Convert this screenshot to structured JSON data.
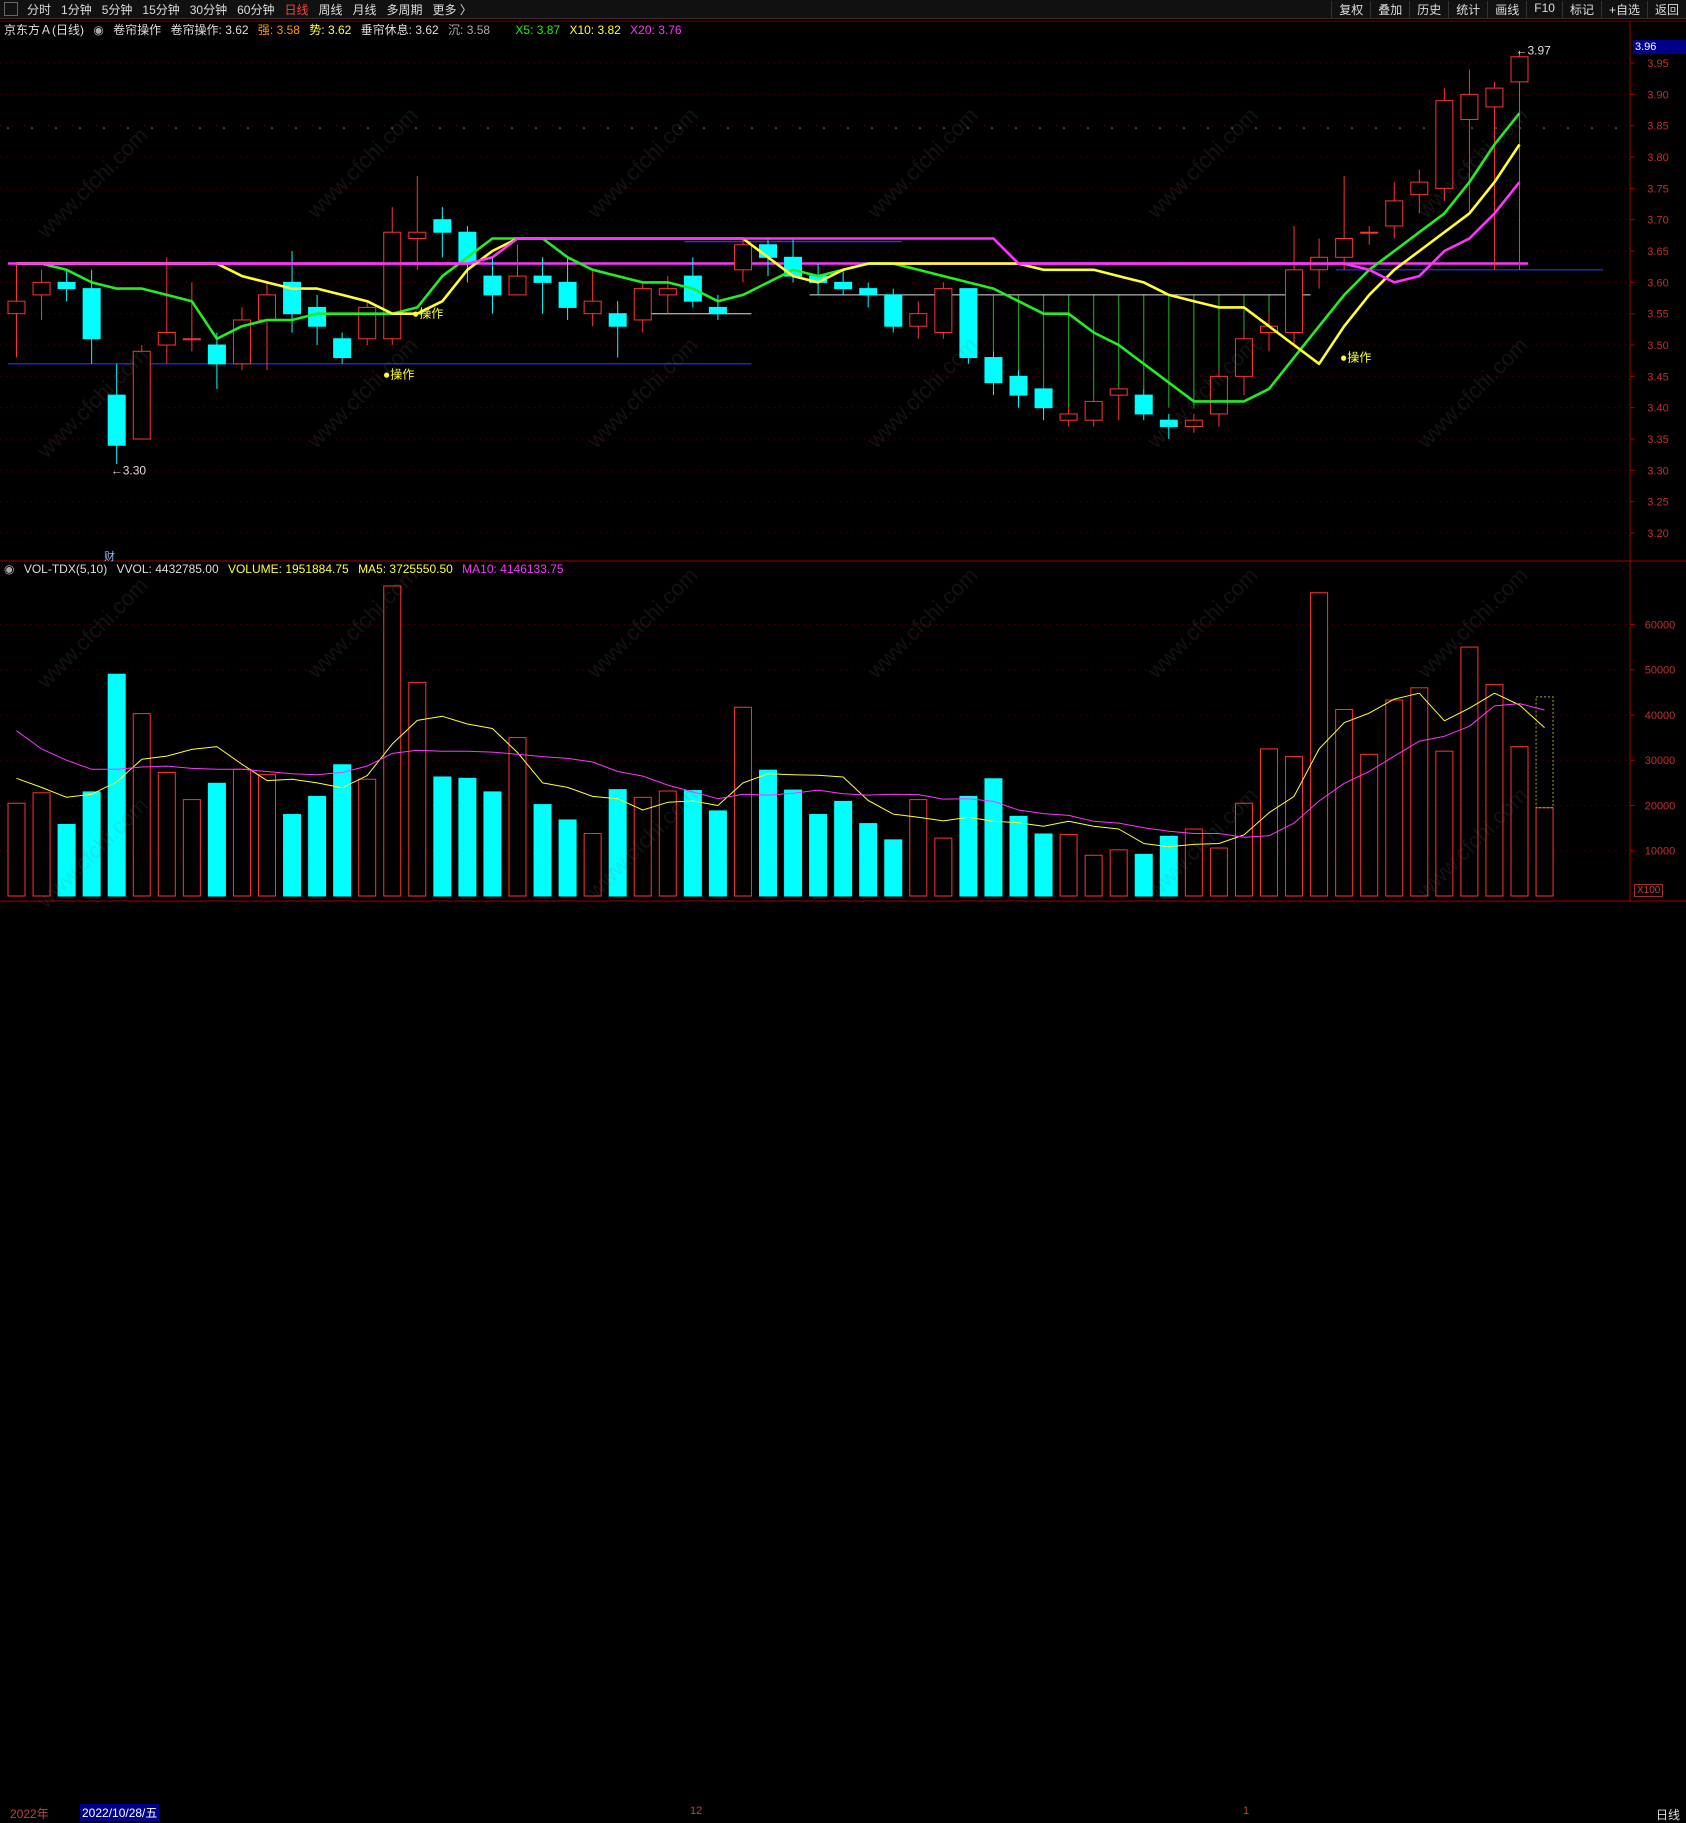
{
  "toolbar": {
    "left_items": [
      "分时",
      "1分钟",
      "5分钟",
      "15分钟",
      "30分钟",
      "60分钟",
      "日线",
      "周线",
      "月线",
      "多周期",
      "更多 〉"
    ],
    "active": "日线",
    "right_items": [
      "复权",
      "叠加",
      "历史",
      "统计",
      "画线",
      "F10",
      "标记",
      "+自选",
      "返回"
    ]
  },
  "legend": {
    "title": "京东方Ａ(日线)",
    "indicator": "卷帘操作",
    "op": "卷帘操作: 3.62",
    "qiang": "强: 3.58",
    "shi": "势: 3.62",
    "rest": "垂帘休息: 3.62",
    "chen": "沉: 3.58",
    "x5": "X5: 3.87",
    "x10": "X10: 3.82",
    "x20": "X20: 3.76"
  },
  "vol_legend": {
    "name": "VOL-TDX(5,10)",
    "vvol": "VVOL: 4432785.00",
    "volume": "VOLUME: 1951884.75",
    "ma5": "MA5: 3725550.50",
    "ma10": "MA10: 4146133.75"
  },
  "annotations": {
    "low": "←3.30",
    "high": "←3.97",
    "cur_price": "3.96",
    "op1": "●操作",
    "op2": "●操作",
    "op3": "●操作",
    "cai": "财",
    "x100": "X100"
  },
  "bottom": {
    "year": "2022年",
    "date": "2022/10/28/五",
    "tick12": "12",
    "tick1": "1",
    "view": "日线"
  },
  "watermark": "www.cfchi.com",
  "colors": {
    "up": "#ff3232",
    "down": "#00ffff",
    "x5": "#22ee22",
    "x10": "#ffff33",
    "x20": "#ff33ff",
    "ma5": "#ffff33",
    "ma10": "#ff33ff",
    "grid": "#5a0000"
  },
  "chart_data": [
    {
      "type": "candlestick",
      "ylim": [
        3.15,
        4.0
      ],
      "yticks": [
        3.2,
        3.25,
        3.3,
        3.35,
        3.4,
        3.45,
        3.5,
        3.55,
        3.6,
        3.65,
        3.7,
        3.75,
        3.8,
        3.85,
        3.9,
        3.95
      ],
      "candles": [
        {
          "o": 3.55,
          "h": 3.63,
          "l": 3.48,
          "c": 3.57
        },
        {
          "o": 3.58,
          "h": 3.62,
          "l": 3.54,
          "c": 3.6
        },
        {
          "o": 3.6,
          "h": 3.62,
          "l": 3.57,
          "c": 3.59
        },
        {
          "o": 3.59,
          "h": 3.62,
          "l": 3.47,
          "c": 3.51
        },
        {
          "o": 3.42,
          "h": 3.47,
          "l": 3.31,
          "c": 3.34
        },
        {
          "o": 3.35,
          "h": 3.5,
          "l": 3.35,
          "c": 3.49
        },
        {
          "o": 3.5,
          "h": 3.64,
          "l": 3.47,
          "c": 3.52
        },
        {
          "o": 3.51,
          "h": 3.6,
          "l": 3.49,
          "c": 3.51
        },
        {
          "o": 3.5,
          "h": 3.52,
          "l": 3.43,
          "c": 3.47
        },
        {
          "o": 3.47,
          "h": 3.56,
          "l": 3.46,
          "c": 3.54
        },
        {
          "o": 3.54,
          "h": 3.6,
          "l": 3.46,
          "c": 3.58
        },
        {
          "o": 3.6,
          "h": 3.65,
          "l": 3.52,
          "c": 3.55
        },
        {
          "o": 3.56,
          "h": 3.58,
          "l": 3.5,
          "c": 3.53
        },
        {
          "o": 3.51,
          "h": 3.52,
          "l": 3.47,
          "c": 3.48
        },
        {
          "o": 3.51,
          "h": 3.57,
          "l": 3.5,
          "c": 3.56
        },
        {
          "o": 3.51,
          "h": 3.72,
          "l": 3.5,
          "c": 3.68
        },
        {
          "o": 3.67,
          "h": 3.77,
          "l": 3.62,
          "c": 3.68
        },
        {
          "o": 3.7,
          "h": 3.72,
          "l": 3.64,
          "c": 3.68
        },
        {
          "o": 3.68,
          "h": 3.69,
          "l": 3.6,
          "c": 3.63
        },
        {
          "o": 3.61,
          "h": 3.64,
          "l": 3.55,
          "c": 3.58
        },
        {
          "o": 3.58,
          "h": 3.66,
          "l": 3.58,
          "c": 3.61
        },
        {
          "o": 3.61,
          "h": 3.64,
          "l": 3.55,
          "c": 3.6
        },
        {
          "o": 3.6,
          "h": 3.64,
          "l": 3.54,
          "c": 3.56
        },
        {
          "o": 3.55,
          "h": 3.62,
          "l": 3.53,
          "c": 3.57
        },
        {
          "o": 3.55,
          "h": 3.57,
          "l": 3.48,
          "c": 3.53
        },
        {
          "o": 3.54,
          "h": 3.6,
          "l": 3.52,
          "c": 3.59
        },
        {
          "o": 3.58,
          "h": 3.61,
          "l": 3.55,
          "c": 3.59
        },
        {
          "o": 3.61,
          "h": 3.64,
          "l": 3.56,
          "c": 3.57
        },
        {
          "o": 3.56,
          "h": 3.58,
          "l": 3.54,
          "c": 3.55
        },
        {
          "o": 3.62,
          "h": 3.67,
          "l": 3.6,
          "c": 3.66
        },
        {
          "o": 3.66,
          "h": 3.67,
          "l": 3.61,
          "c": 3.64
        },
        {
          "o": 3.64,
          "h": 3.67,
          "l": 3.6,
          "c": 3.61
        },
        {
          "o": 3.61,
          "h": 3.63,
          "l": 3.58,
          "c": 3.6
        },
        {
          "o": 3.6,
          "h": 3.62,
          "l": 3.58,
          "c": 3.59
        },
        {
          "o": 3.59,
          "h": 3.6,
          "l": 3.56,
          "c": 3.58
        },
        {
          "o": 3.58,
          "h": 3.59,
          "l": 3.52,
          "c": 3.53
        },
        {
          "o": 3.53,
          "h": 3.57,
          "l": 3.51,
          "c": 3.55
        },
        {
          "o": 3.52,
          "h": 3.6,
          "l": 3.51,
          "c": 3.59
        },
        {
          "o": 3.59,
          "h": 3.59,
          "l": 3.47,
          "c": 3.48
        },
        {
          "o": 3.48,
          "h": 3.49,
          "l": 3.42,
          "c": 3.44
        },
        {
          "o": 3.45,
          "h": 3.46,
          "l": 3.4,
          "c": 3.42
        },
        {
          "o": 3.43,
          "h": 3.43,
          "l": 3.38,
          "c": 3.4
        },
        {
          "o": 3.38,
          "h": 3.4,
          "l": 3.37,
          "c": 3.39
        },
        {
          "o": 3.38,
          "h": 3.42,
          "l": 3.37,
          "c": 3.41
        },
        {
          "o": 3.42,
          "h": 3.43,
          "l": 3.38,
          "c": 3.43
        },
        {
          "o": 3.42,
          "h": 3.43,
          "l": 3.38,
          "c": 3.39
        },
        {
          "o": 3.38,
          "h": 3.39,
          "l": 3.35,
          "c": 3.37
        },
        {
          "o": 3.37,
          "h": 3.39,
          "l": 3.36,
          "c": 3.38
        },
        {
          "o": 3.39,
          "h": 3.46,
          "l": 3.37,
          "c": 3.45
        },
        {
          "o": 3.45,
          "h": 3.52,
          "l": 3.42,
          "c": 3.51
        },
        {
          "o": 3.52,
          "h": 3.55,
          "l": 3.49,
          "c": 3.53
        },
        {
          "o": 3.52,
          "h": 3.69,
          "l": 3.5,
          "c": 3.62
        },
        {
          "o": 3.62,
          "h": 3.67,
          "l": 3.59,
          "c": 3.64
        },
        {
          "o": 3.64,
          "h": 3.77,
          "l": 3.62,
          "c": 3.67
        },
        {
          "o": 3.68,
          "h": 3.69,
          "l": 3.66,
          "c": 3.68
        },
        {
          "o": 3.69,
          "h": 3.76,
          "l": 3.67,
          "c": 3.73
        },
        {
          "o": 3.74,
          "h": 3.78,
          "l": 3.71,
          "c": 3.76
        },
        {
          "o": 3.75,
          "h": 3.91,
          "l": 3.73,
          "c": 3.89
        },
        {
          "o": 3.86,
          "h": 3.94,
          "l": 3.71,
          "c": 3.9
        },
        {
          "o": 3.88,
          "h": 3.92,
          "l": 3.62,
          "c": 3.91
        },
        {
          "o": 3.92,
          "h": 3.97,
          "l": 3.62,
          "c": 3.96
        }
      ],
      "series": [
        {
          "name": "X5",
          "values": [
            3.63,
            3.63,
            3.62,
            3.6,
            3.59,
            3.59,
            3.58,
            3.57,
            3.51,
            3.53,
            3.54,
            3.54,
            3.55,
            3.55,
            3.55,
            3.55,
            3.56,
            3.61,
            3.64,
            3.67,
            3.67,
            3.67,
            3.64,
            3.62,
            3.61,
            3.6,
            3.6,
            3.59,
            3.57,
            3.58,
            3.6,
            3.62,
            3.61,
            3.62,
            3.63,
            3.63,
            3.62,
            3.61,
            3.6,
            3.59,
            3.57,
            3.55,
            3.55,
            3.52,
            3.5,
            3.47,
            3.44,
            3.41,
            3.41,
            3.41,
            3.43,
            3.48,
            3.53,
            3.58,
            3.62,
            3.65,
            3.68,
            3.71,
            3.76,
            3.82,
            3.87
          ]
        },
        {
          "name": "X10",
          "values": [
            3.63,
            3.63,
            3.63,
            3.63,
            3.63,
            3.63,
            3.63,
            3.63,
            3.63,
            3.61,
            3.6,
            3.59,
            3.59,
            3.58,
            3.57,
            3.55,
            3.55,
            3.57,
            3.62,
            3.65,
            3.67,
            3.67,
            3.67,
            3.67,
            3.67,
            3.67,
            3.67,
            3.67,
            3.67,
            3.67,
            3.64,
            3.61,
            3.6,
            3.62,
            3.63,
            3.63,
            3.63,
            3.63,
            3.63,
            3.63,
            3.63,
            3.62,
            3.62,
            3.62,
            3.61,
            3.6,
            3.58,
            3.57,
            3.56,
            3.56,
            3.53,
            3.5,
            3.47,
            3.53,
            3.58,
            3.62,
            3.65,
            3.68,
            3.71,
            3.76,
            3.82
          ]
        },
        {
          "name": "X20",
          "values": [
            3.63,
            3.63,
            3.63,
            3.63,
            3.63,
            3.63,
            3.63,
            3.63,
            3.63,
            3.63,
            3.63,
            3.63,
            3.63,
            3.63,
            3.63,
            3.63,
            3.63,
            3.63,
            3.63,
            3.64,
            3.67,
            3.67,
            3.67,
            3.67,
            3.67,
            3.67,
            3.67,
            3.67,
            3.67,
            3.67,
            3.67,
            3.67,
            3.67,
            3.67,
            3.67,
            3.67,
            3.67,
            3.67,
            3.67,
            3.67,
            3.63,
            3.63,
            3.63,
            3.63,
            3.63,
            3.63,
            3.63,
            3.63,
            3.63,
            3.63,
            3.63,
            3.63,
            3.63,
            3.63,
            3.62,
            3.6,
            3.61,
            3.65,
            3.67,
            3.71,
            3.76
          ]
        }
      ],
      "levels": [
        {
          "value": 3.63,
          "from": 0,
          "to": 60,
          "color": "#ff33ff"
        },
        {
          "value": 3.47,
          "from": 0,
          "to": 29,
          "color": "#3030ff"
        },
        {
          "value": 3.62,
          "from": 53,
          "to": 63,
          "color": "#3030ff"
        },
        {
          "value": 3.665,
          "from": 27,
          "to": 35,
          "color": "#3030ff"
        }
      ]
    },
    {
      "type": "bar",
      "ylim": [
        0,
        70000
      ],
      "yticks": [
        10000,
        20000,
        30000,
        40000,
        50000,
        60000
      ],
      "volume": [
        20500,
        22800,
        15800,
        23000,
        49000,
        40300,
        27300,
        21300,
        24900,
        28000,
        26800,
        18000,
        22000,
        29000,
        25800,
        68500,
        47200,
        26300,
        26000,
        23000,
        35000,
        20200,
        16800,
        13800,
        23500,
        21800,
        23200,
        23300,
        18800,
        41700,
        27800,
        23400,
        18000,
        20900,
        16000,
        12400,
        21300,
        12800,
        22000,
        25900,
        17600,
        13700,
        13600,
        9000,
        10200,
        9200,
        13200,
        14800,
        10600,
        20500,
        32500,
        30800,
        67000,
        41200,
        31300,
        43300,
        46000,
        32000,
        55000,
        46700,
        33000,
        19500
      ],
      "ma5": [
        26000,
        24000,
        21800,
        22500,
        25200,
        30200,
        30900,
        32400,
        33000,
        29100,
        25500,
        25800,
        25000,
        23900,
        26600,
        33600,
        38800,
        39700,
        38000,
        37000,
        31700,
        25000,
        24000,
        22000,
        21500,
        19000,
        20700,
        21000,
        20000,
        25000,
        27000,
        26800,
        26700,
        26300,
        21100,
        18100,
        17400,
        16600,
        17400,
        16500,
        16200,
        15400,
        16500,
        15400,
        14800,
        11600,
        10900,
        11400,
        11600,
        13500,
        18400,
        22000,
        32500,
        38300,
        40400,
        43500,
        44800,
        38700,
        41500,
        44800,
        42200,
        37200
      ],
      "ma10": [
        36500,
        32500,
        30000,
        28000,
        28000,
        28500,
        28700,
        28200,
        28000,
        28000,
        27500,
        27000,
        26800,
        27300,
        28700,
        31500,
        32200,
        32000,
        32000,
        31800,
        31300,
        30800,
        30400,
        29600,
        27500,
        26500,
        24500,
        23000,
        21500,
        22500,
        22300,
        22700,
        23400,
        22600,
        22300,
        22500,
        22400,
        21400,
        21500,
        20900,
        19000,
        18200,
        17800,
        16500,
        16100,
        15100,
        14300,
        13800,
        13800,
        13000,
        13300,
        16100,
        21000,
        24900,
        27500,
        30900,
        34200,
        35300,
        37500,
        42000,
        42500,
        41100
      ]
    }
  ]
}
